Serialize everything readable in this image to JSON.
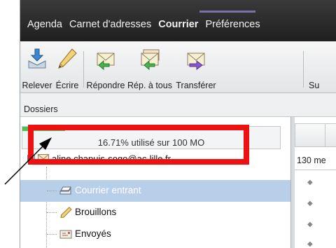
{
  "nav": {
    "items": [
      "Agenda",
      "Carnet d'adresses",
      "Courrier",
      "Préférences"
    ],
    "active": "Courrier"
  },
  "toolbar": {
    "buttons": [
      {
        "label": "Relever",
        "icon": "fetch-mail-icon"
      },
      {
        "label": "Écrire",
        "icon": "pencil-icon"
      },
      {
        "label": "Répondre",
        "icon": "reply-icon"
      },
      {
        "label": "Rép. à tous",
        "icon": "reply-all-icon"
      },
      {
        "label": "Transférer",
        "icon": "forward-icon"
      },
      {
        "label": "Su",
        "icon": ""
      }
    ]
  },
  "folders_panel": {
    "title": "Dossiers",
    "quota": {
      "text": "16.71% utilisé sur 100 MO",
      "used_fraction": 0.1671
    },
    "account": "aline.chapuis-sogo@ac-lille.fr",
    "folders": [
      {
        "label": "Courrier entrant",
        "icon": "inbox-icon",
        "selected": true
      },
      {
        "label": "Brouillons",
        "icon": "pencil-icon",
        "selected": false
      },
      {
        "label": "Envoyés",
        "icon": "sent-icon",
        "selected": false
      }
    ]
  },
  "messages_panel": {
    "count_text": "130 me"
  },
  "colors": {
    "annotation": "#ee1111",
    "selection": "#b7cfe8",
    "quota_fill": "#4fc14f",
    "navbar": "#2a2a2a"
  }
}
